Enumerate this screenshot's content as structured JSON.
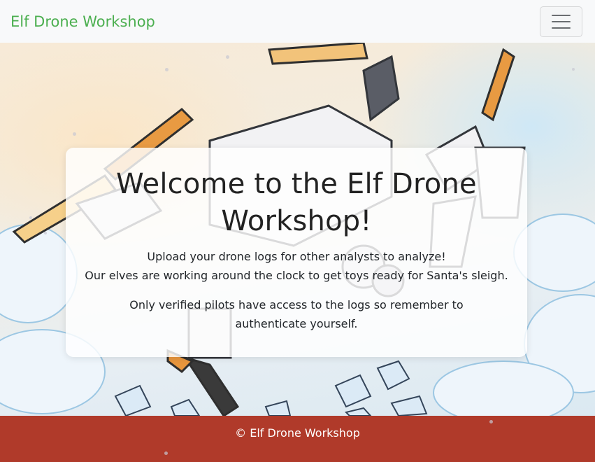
{
  "navbar": {
    "brand": "Elf Drone Workshop",
    "toggler_icon": "hamburger-menu-icon"
  },
  "hero": {
    "background_image": "drone-illustration"
  },
  "welcome": {
    "title": "Welcome to the Elf Drone Workshop!",
    "line1": "Upload your drone logs for other analysts to analyze!",
    "line2": "Our elves are working around the clock to get toys ready for Santa's sleigh.",
    "line3": "Only verified pilots have access to the logs so remember to authenticate yourself."
  },
  "footer": {
    "text": "© Elf Drone Workshop"
  },
  "colors": {
    "brand": "#4caf50",
    "footer_bg": "#b03a2a",
    "navbar_bg": "#f8f9fa"
  }
}
